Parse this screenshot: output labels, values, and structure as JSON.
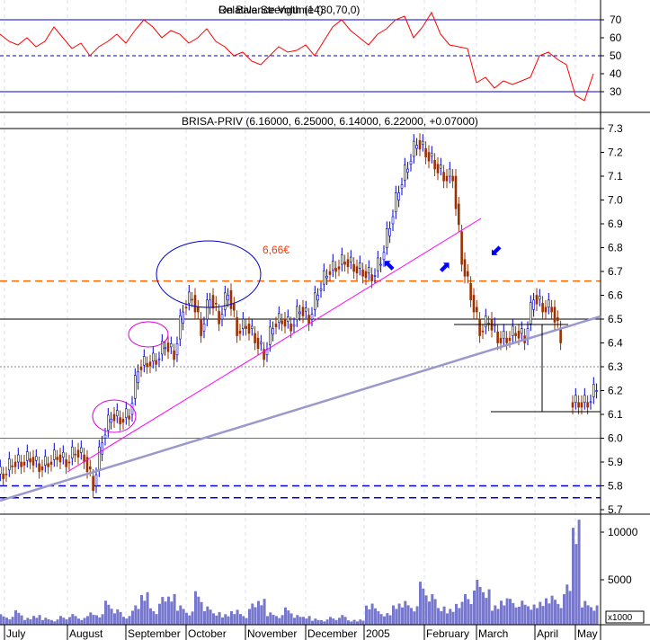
{
  "chart_data": [
    {
      "type": "line",
      "panel": "indicator",
      "title_overlapped": [
        "Relative Strength (14)",
        "On Balance Volume (30,70,0)"
      ],
      "yticks": [
        30,
        40,
        50,
        60,
        70
      ],
      "reference_lines": [
        {
          "value": 70,
          "style": "solid"
        },
        {
          "value": 50,
          "style": "dashed"
        },
        {
          "value": 30,
          "style": "solid"
        }
      ],
      "ylim": [
        18,
        78
      ],
      "series_color": "#ff0000",
      "values": [
        62,
        58,
        56,
        60,
        55,
        58,
        66,
        60,
        54,
        57,
        50,
        55,
        58,
        62,
        57,
        64,
        70,
        66,
        60,
        64,
        62,
        57,
        60,
        65,
        58,
        55,
        50,
        52,
        47,
        45,
        50,
        55,
        52,
        53,
        56,
        50,
        58,
        66,
        70,
        64,
        60,
        56,
        62,
        65,
        70,
        72,
        60,
        66,
        74,
        62,
        56,
        55,
        54,
        35,
        38,
        32,
        36,
        34,
        36,
        38,
        50,
        52,
        48,
        45,
        28,
        25,
        40
      ],
      "xticks": [
        "July",
        "August",
        "September",
        "October",
        "November",
        "December",
        "2005",
        "February",
        "March",
        "April",
        "May"
      ]
    },
    {
      "type": "candlestick",
      "panel": "price",
      "title": "BRISA-PRIV (6.16000, 6.25000, 6.14000, 6.22000, +0.07000)",
      "yticks": [
        5.7,
        5.8,
        5.9,
        6.0,
        6.1,
        6.2,
        6.3,
        6.4,
        6.5,
        6.6,
        6.7,
        6.8,
        6.9,
        7.0,
        7.1,
        7.2,
        7.3
      ],
      "ylim": [
        5.6,
        7.35
      ],
      "close": [
        5.85,
        5.9,
        5.9,
        5.92,
        5.88,
        5.9,
        5.93,
        5.9,
        5.95,
        5.92,
        5.8,
        6.0,
        6.1,
        6.08,
        6.1,
        6.3,
        6.32,
        6.33,
        6.4,
        6.35,
        6.55,
        6.6,
        6.45,
        6.6,
        6.5,
        6.62,
        6.45,
        6.48,
        6.42,
        6.35,
        6.48,
        6.5,
        6.47,
        6.55,
        6.5,
        6.62,
        6.7,
        6.72,
        6.75,
        6.72,
        6.7,
        6.68,
        6.75,
        6.9,
        7.05,
        7.15,
        7.25,
        7.2,
        7.15,
        7.1,
        7.1,
        6.75,
        6.6,
        6.45,
        6.5,
        6.42,
        6.42,
        6.45,
        6.42,
        6.6,
        6.55,
        6.55,
        6.42,
        null,
        6.15,
        6.15,
        6.22
      ],
      "horizontal_lines": [
        {
          "value": 7.3,
          "color": "#000000",
          "style": "solid"
        },
        {
          "value": 6.66,
          "color": "#ff6600",
          "style": "dashed",
          "label": "6,66€"
        },
        {
          "value": 6.5,
          "color": "#000000",
          "style": "solid"
        },
        {
          "value": 6.3,
          "color": "#888888",
          "style": "dotted"
        },
        {
          "value": 6.0,
          "color": "#6666aa",
          "style": "solid"
        },
        {
          "value": 5.8,
          "color": "#0000dd",
          "style": "dashed"
        },
        {
          "value": 5.75,
          "color": "#0000dd",
          "style": "dashed"
        }
      ],
      "up_color": "#0000cc",
      "down_color": "#993300"
    },
    {
      "type": "bar",
      "panel": "volume",
      "unit_label": "x1000",
      "yticks": [
        5000,
        10000
      ],
      "color": "#7777cc",
      "values": [
        1500,
        1200,
        1800,
        1000,
        1300,
        1100,
        900,
        1200,
        1400,
        1000,
        1700,
        1500,
        2800,
        1900,
        1200,
        2500,
        4000,
        2000,
        3200,
        3500,
        2500,
        1800,
        3800,
        2200,
        1600,
        1500,
        2000,
        1400,
        2500,
        3000,
        1700,
        1400,
        2100,
        1300,
        1200,
        1000,
        900,
        1100,
        1300,
        800,
        900,
        2700,
        2000,
        1500,
        2500,
        3000,
        2400,
        4800,
        3500,
        2200,
        2100,
        2900,
        3500,
        5000,
        4000,
        2500,
        3300,
        3000,
        2800,
        2400,
        2900,
        3600,
        2900,
        4500,
        11300,
        3000,
        2500
      ]
    }
  ]
}
